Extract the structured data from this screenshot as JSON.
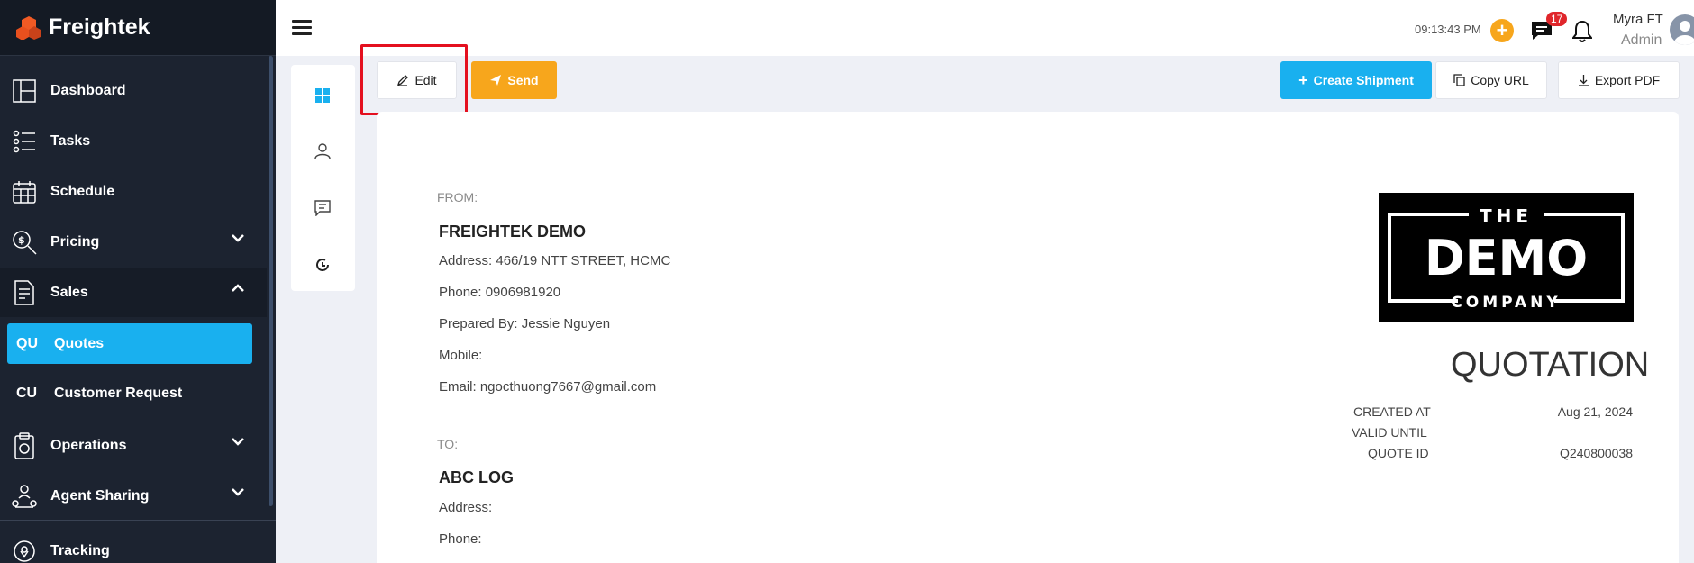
{
  "app": {
    "name": "Freightek"
  },
  "sidebar": {
    "items": [
      {
        "label": "Dashboard"
      },
      {
        "label": "Tasks"
      },
      {
        "label": "Schedule"
      },
      {
        "label": "Pricing"
      },
      {
        "label": "Sales"
      },
      {
        "abbr": "QU",
        "label": "Quotes"
      },
      {
        "abbr": "CU",
        "label": "Customer Request"
      },
      {
        "label": "Operations"
      },
      {
        "label": "Agent Sharing"
      },
      {
        "label": "Tracking"
      }
    ]
  },
  "topbar": {
    "time": "09:13:43 PM",
    "chat_count": "17",
    "user_name": "Myra FT",
    "user_role": "Admin"
  },
  "toolbar": {
    "edit_label": "Edit",
    "send_label": "Send",
    "create_label": "Create Shipment",
    "copy_label": "Copy URL",
    "export_label": "Export PDF"
  },
  "document": {
    "from_label": "FROM:",
    "from": {
      "company": "FREIGHTEK DEMO",
      "address": "Address: 466/19 NTT STREET, HCMC",
      "phone": "Phone: 0906981920",
      "prepared": "Prepared By: Jessie Nguyen",
      "mobile": "Mobile:",
      "email": "Email: ngocthuong7667@gmail.com"
    },
    "to_label": "TO:",
    "to": {
      "company": "ABC LOG",
      "address": "Address:",
      "phone": "Phone:"
    },
    "logo": {
      "top": "THE",
      "main": "DEMO",
      "bottom": "COMPANY"
    },
    "title": "QUOTATION",
    "meta": {
      "created_label": "CREATED AT",
      "created_value": "Aug 21, 2024",
      "valid_label": "VALID UNTIL",
      "quote_label": "QUOTE ID",
      "quote_value": "Q240800038"
    }
  },
  "colors": {
    "accent": "#19b0ef",
    "send": "#f7a61c",
    "highlight": "#e4101f",
    "sidebar": "#1c2330"
  }
}
